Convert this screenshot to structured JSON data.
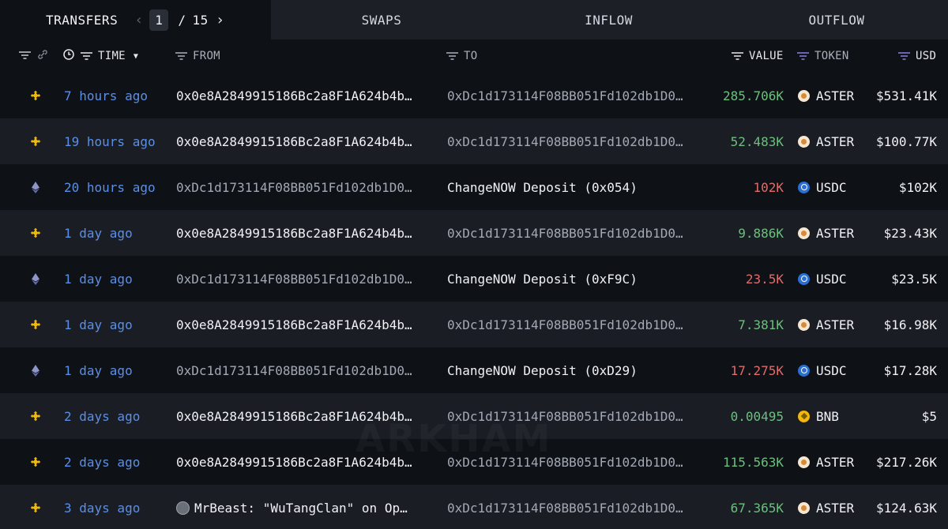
{
  "tabs": {
    "transfers": "TRANSFERS",
    "swaps": "SWAPS",
    "inflow": "INFLOW",
    "outflow": "OUTFLOW"
  },
  "pager": {
    "current": "1",
    "separator": "/",
    "total": "15",
    "prev_icon": "chevron-left",
    "next_icon": "chevron-right"
  },
  "columns": {
    "time": "TIME",
    "from": "FROM",
    "to": "TO",
    "value": "VALUE",
    "token": "TOKEN",
    "usd": "USD"
  },
  "watermark": "ARKHAM",
  "colors": {
    "time_link": "#5b8fe6",
    "value_in": "#6dbf7f",
    "value_out": "#e06c6c",
    "background": "#0e1116",
    "alt_row": "#1a1d24"
  },
  "rows": [
    {
      "chain": "bnb-chain-icon",
      "time": "7 hours ago",
      "from": "0x0e8A2849915186Bc2a8F1A624b4b…",
      "to": "0xDc1d173114F08BB051Fd102db1D0…",
      "value": "285.706K",
      "token": "ASTER",
      "usd": "$531.41K"
    },
    {
      "chain": "bnb-chain-icon",
      "time": "19 hours ago",
      "from": "0x0e8A2849915186Bc2a8F1A624b4b…",
      "to": "0xDc1d173114F08BB051Fd102db1D0…",
      "value": "52.483K",
      "token": "ASTER",
      "usd": "$100.77K"
    },
    {
      "chain": "ethereum-icon",
      "time": "20 hours ago",
      "from": "0xDc1d173114F08BB051Fd102db1D0…",
      "to": "ChangeNOW Deposit (0x054)",
      "value": "102K",
      "token": "USDC",
      "usd": "$102K"
    },
    {
      "chain": "bnb-chain-icon",
      "time": "1 day ago",
      "from": "0x0e8A2849915186Bc2a8F1A624b4b…",
      "to": "0xDc1d173114F08BB051Fd102db1D0…",
      "value": "9.886K",
      "token": "ASTER",
      "usd": "$23.43K"
    },
    {
      "chain": "ethereum-icon",
      "time": "1 day ago",
      "from": "0xDc1d173114F08BB051Fd102db1D0…",
      "to": "ChangeNOW Deposit (0xF9C)",
      "value": "23.5K",
      "token": "USDC",
      "usd": "$23.5K"
    },
    {
      "chain": "bnb-chain-icon",
      "time": "1 day ago",
      "from": "0x0e8A2849915186Bc2a8F1A624b4b…",
      "to": "0xDc1d173114F08BB051Fd102db1D0…",
      "value": "7.381K",
      "token": "ASTER",
      "usd": "$16.98K"
    },
    {
      "chain": "ethereum-icon",
      "time": "1 day ago",
      "from": "0xDc1d173114F08BB051Fd102db1D0…",
      "to": "ChangeNOW Deposit (0xD29)",
      "value": "17.275K",
      "token": "USDC",
      "usd": "$17.28K"
    },
    {
      "chain": "bnb-chain-icon",
      "time": "2 days ago",
      "from": "0x0e8A2849915186Bc2a8F1A624b4b…",
      "to": "0xDc1d173114F08BB051Fd102db1D0…",
      "value": "0.00495",
      "token": "BNB",
      "usd": "$5"
    },
    {
      "chain": "bnb-chain-icon",
      "time": "2 days ago",
      "from": "0x0e8A2849915186Bc2a8F1A624b4b…",
      "to": "0xDc1d173114F08BB051Fd102db1D0…",
      "value": "115.563K",
      "token": "ASTER",
      "usd": "$217.26K"
    },
    {
      "chain": "bnb-chain-icon",
      "time": "3 days ago",
      "from": "MrBeast: \"WuTangClan\" on Op…",
      "to": "0xDc1d173114F08BB051Fd102db1D0…",
      "value": "67.365K",
      "token": "ASTER",
      "usd": "$124.63K"
    }
  ]
}
